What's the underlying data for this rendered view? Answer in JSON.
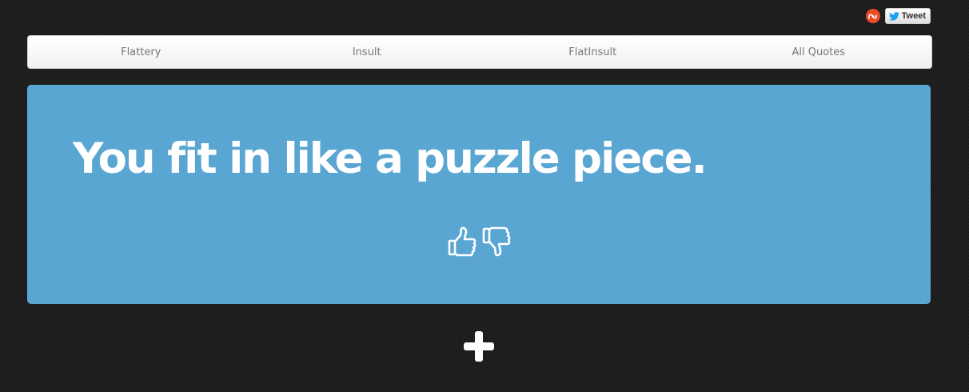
{
  "share": {
    "stumble_icon": "stumbleupon-icon",
    "stumble_color": "#eb4924",
    "tweet_icon": "twitter-bird-icon",
    "tweet_color": "#1da1f2",
    "tweet_label": "Tweet"
  },
  "nav": {
    "items": [
      {
        "label": "Flattery"
      },
      {
        "label": "Insult"
      },
      {
        "label": "FlatInsult"
      },
      {
        "label": "All Quotes"
      }
    ]
  },
  "quote": {
    "text": "You fit in like a puzzle piece.",
    "card_color": "#5aa6d2",
    "upvote_icon": "thumbs-up-icon",
    "downvote_icon": "thumbs-down-icon"
  },
  "add": {
    "icon": "plus-icon"
  },
  "colors": {
    "background": "#1f1f1f",
    "accent": "#5aa6d2"
  }
}
